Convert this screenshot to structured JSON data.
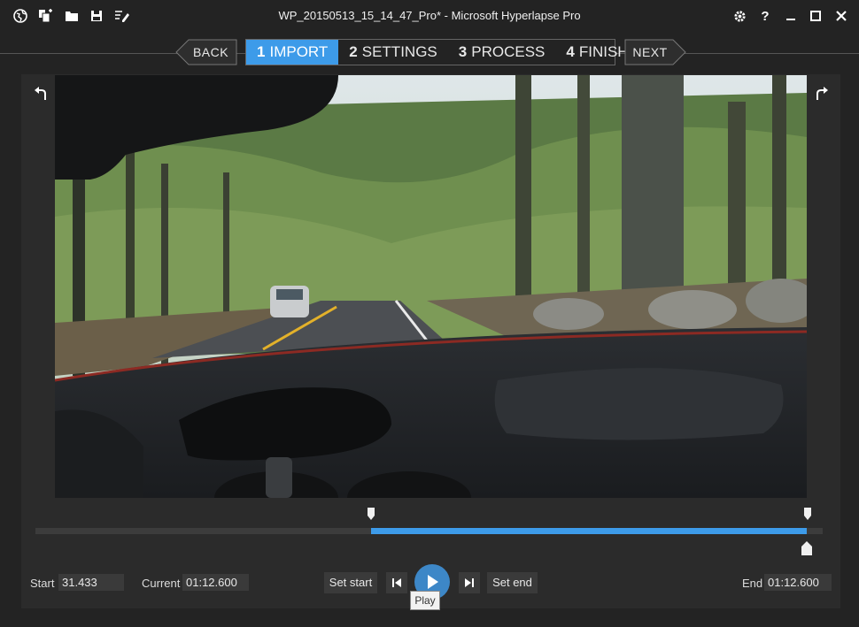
{
  "window": {
    "title": "WP_20150513_15_14_47_Pro* - Microsoft Hyperlapse Pro"
  },
  "toolbar": {
    "icons": [
      "globe-icon",
      "import-files-icon",
      "open-folder-icon",
      "save-icon",
      "edit-checklist-icon"
    ]
  },
  "window_controls": {
    "icons": [
      "settings-icon",
      "help-icon",
      "minimize-icon",
      "maximize-icon",
      "close-icon"
    ],
    "help_label": "?"
  },
  "wizard": {
    "back_label": "BACK",
    "next_label": "NEXT",
    "steps": [
      {
        "num": "1",
        "label": "IMPORT",
        "active": true
      },
      {
        "num": "2",
        "label": "SETTINGS",
        "active": false
      },
      {
        "num": "3",
        "label": "PROCESS",
        "active": false
      },
      {
        "num": "4",
        "label": "FINISH",
        "active": false
      }
    ]
  },
  "timeline": {
    "start_fraction": 0.426,
    "end_fraction": 0.98,
    "current_fraction": 0.98
  },
  "controls": {
    "start_label": "Start",
    "start_value": "31.433",
    "current_label": "Current",
    "current_value": "01:12.600",
    "set_start_label": "Set start",
    "set_end_label": "Set end",
    "end_label": "End",
    "end_value": "01:12.600",
    "play_tooltip": "Play"
  },
  "colors": {
    "accent": "#3d9be9",
    "play": "#3d87c7",
    "background": "#232323"
  }
}
